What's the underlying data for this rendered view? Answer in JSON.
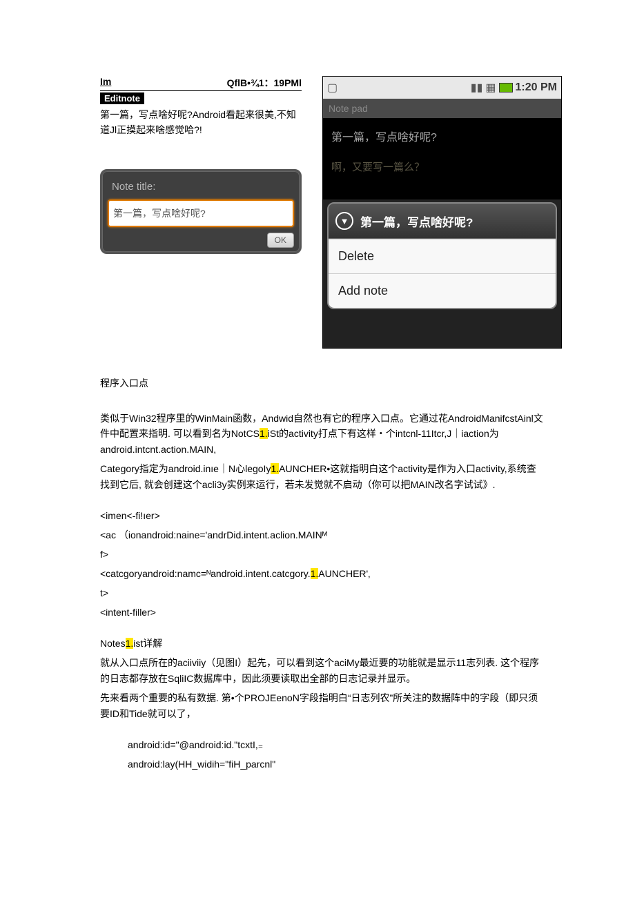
{
  "left": {
    "header_left": "Im",
    "header_right": "QflB•¾1：19PMl",
    "editnote_label": "Editnote",
    "paragraph": "第一篇，写点啥好呢?Android看起来很美,不知道Jl正摸起来啥感觉哈?!",
    "note_title_label": "Note title:",
    "note_title_value": "第一篇，写点啥好呢?",
    "ok_label": "OK"
  },
  "phone": {
    "time": "1:20 PM",
    "header": "Note pad",
    "line1": "第一篇，写点啥好呢?",
    "line2": "啊，又要写一篇么？",
    "ctx_title": "第一篇，写点啥好呢?",
    "delete_label": "Delete",
    "addnote_label": "Add note"
  },
  "body": {
    "section1_title": "程序入口点",
    "p1a": "类似于Win32程序里的WinMain函数，Andwid自然也有它的程序入口点。它通过花AndroidManifcstAinl文件中配置来指明. 可以看到名为NotCS",
    "p1b": "iSt的activity打点下有这样・个intcnl-11Itcr,J｜iaction为android.intcnt.action.MAIN,",
    "p1c": "Category指定为android.inıe｜N心legoIy",
    "p1d": "AUNCHER•这就指明白这个activity是作为入口activity,系统查找到它后, 就会创建这个acli3y实例来运行，若未发觉就不启动（你可以把MAIN改名字试试》.",
    "code1": "<imen<-fi!ıer>",
    "code2": "<ac （ionandroid:naine='andrDid.intent.aclion.MAINᴹ",
    "code3": "f>",
    "code4a": "<catcgoryandroid:namc=ᴺandroid.intent.catcgory.",
    "code4b": "AUNCHER'",
    "code4c": "‚",
    "code5": "t>",
    "code6": "<intent-filler>",
    "section2a": "Notes",
    "section2b": "ist详解",
    "p2": "就从入口点所在的aciiviiy（见图I）起先，可以看到这个aciMy最近要的功能就是显示11志列表. 这个程序的日志都存放在SqliIC数据库中，因此须要读取出全部的日志记录并显示。",
    "p3": "先来看两个重要的私有数据. 第•个PROJEenoN字段指明白“日志列农”所关注的数据阵中的字段（即只须要ID和Tide就可以了，",
    "code7": "android:id=\"@android:id.\"tcxtI,₌",
    "code8": "android:lay(HH_widih=\"fiH_parcnl\""
  }
}
